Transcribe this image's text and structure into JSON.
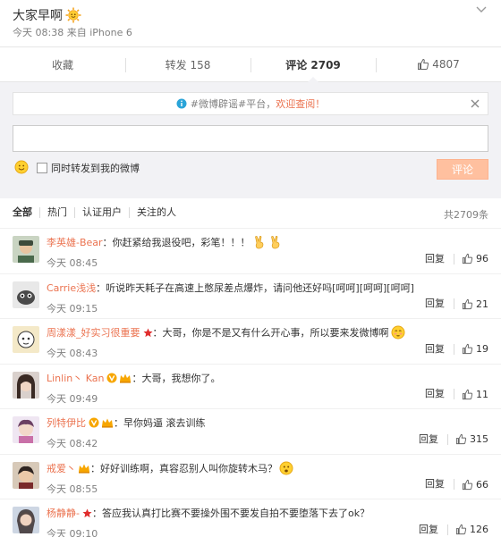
{
  "post": {
    "text": "大家早啊",
    "time": "今天 08:38",
    "source_prefix": "来自",
    "source": "iPhone 6"
  },
  "actions": {
    "favorite": "收藏",
    "repost": "转发 158",
    "comment": "评论 2709",
    "like": "4807"
  },
  "notice": {
    "tag": "#微博辟谣#平台，",
    "highlight": "欢迎查阅！"
  },
  "composer": {
    "input_value": "",
    "repost_label": "同时转发到我的微博",
    "submit": "评论"
  },
  "filters": {
    "items": [
      "全部",
      "热门",
      "认证用户",
      "关注的人"
    ],
    "count": "共2709条"
  },
  "comment_ops": {
    "reply": "回复"
  },
  "comments": [
    {
      "user": "李英雄-Bear",
      "text": "：你赶紧给我退役吧，彩笔！！！",
      "time": "今天 08:45",
      "likes": "96"
    },
    {
      "user": "Carrie浅浅",
      "text": "：听说昨天耗子在高速上憋尿差点爆炸，请问他还好吗[呵呵][呵呵][呵呵]",
      "time": "今天 09:15",
      "likes": "21"
    },
    {
      "user": "周漾漾_好实习很重要",
      "text": "：大哥，你是不是又有什么开心事，所以要来发微博啊",
      "time": "今天 08:43",
      "likes": "19"
    },
    {
      "user": "Linlin丶 Kan",
      "text": "：大哥，我想你了。",
      "time": "今天 09:49",
      "likes": "11"
    },
    {
      "user": "列特伊比",
      "text": "：早你妈逼 滚去训练",
      "time": "今天 08:42",
      "likes": "315"
    },
    {
      "user": "戒爱丶",
      "text": "：好好训练啊，真容忍别人叫你旋转木马？",
      "time": "今天 08:55",
      "likes": "66"
    },
    {
      "user": "杨静静-",
      "text": "：答应我认真打比赛不要操外围不要发自拍不要堕落下去了ok？",
      "time": "今天 09:10",
      "likes": "126"
    }
  ],
  "colors": {
    "username": "#eb7350",
    "meta": "#808080",
    "panel_bg": "#f2f2f5",
    "submit_bg": "#ffc09f"
  }
}
